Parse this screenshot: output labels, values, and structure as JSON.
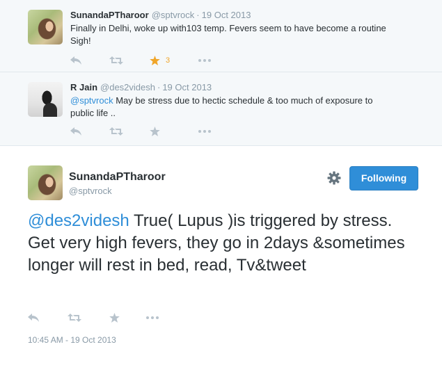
{
  "tweets": [
    {
      "fullname": "SunandaPTharoor",
      "username": "@sptvrock",
      "separator": "·",
      "date": "19 Oct 2013",
      "text_line1": "Finally in Delhi, woke up with103 temp. Fevers seem to have become a routine",
      "text_line2": "Sigh!",
      "favorites": "3",
      "favorited": true
    },
    {
      "fullname": "R Jain",
      "username": "@des2videsh",
      "separator": "·",
      "date": "19 Oct 2013",
      "mention": "@sptvrock",
      "text_line1_rest": " May be stress due to hectic schedule & too much of exposure to",
      "text_line2": "public life .."
    }
  ],
  "main_tweet": {
    "fullname": "SunandaPTharoor",
    "username": "@sptvrock",
    "follow_label": "Following",
    "mention": "@des2videsh",
    "text_rest": " True( Lupus )is triggered by stress. Get very high fevers, they go in 2days &sometimes longer will rest in bed, read, Tv&tweet",
    "timestamp": "10:45 AM - 19 Oct 2013"
  },
  "icons": {
    "reply": "reply-icon",
    "retweet": "retweet-icon",
    "favorite": "star-icon",
    "more": "more-icon",
    "settings": "gear-icon"
  },
  "colors": {
    "link": "#2f8ed8",
    "favorited_star": "#f0a529",
    "muted": "#8899a6",
    "button": "#2f8ed8"
  }
}
